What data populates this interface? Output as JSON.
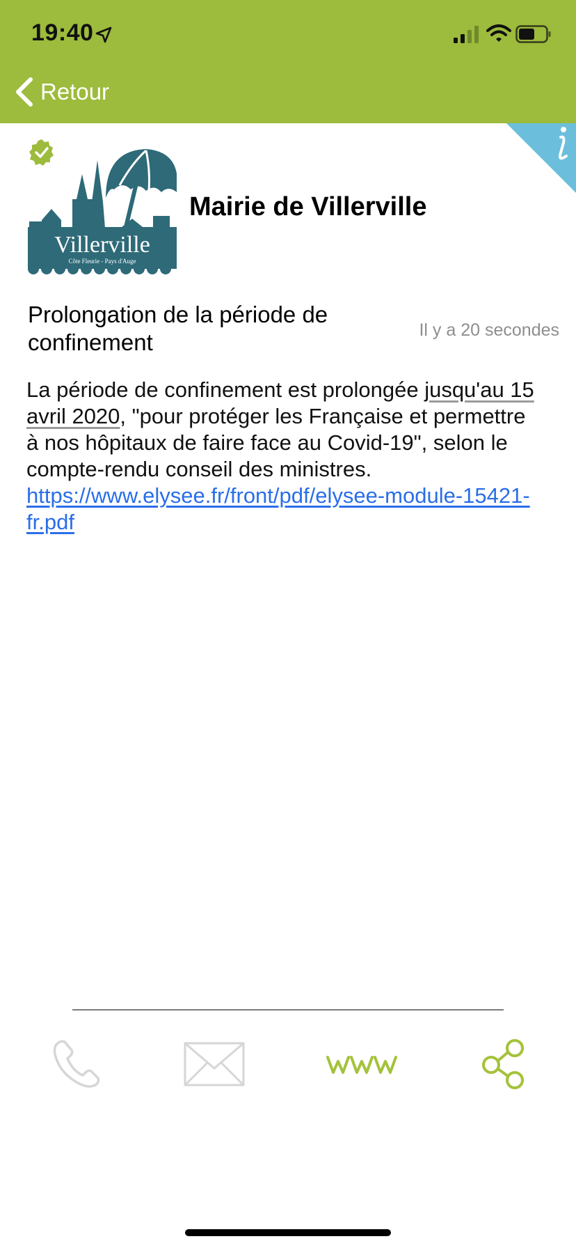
{
  "status_bar": {
    "time": "19:40"
  },
  "nav": {
    "back_label": "Retour"
  },
  "publisher": {
    "name": "Mairie de Villerville",
    "logo_text": "Villerville",
    "logo_subtext": "Côte Fleurie - Pays d'Auge"
  },
  "article": {
    "title": "Prolongation de la période de confinement",
    "timestamp": "Il y a 20 secondes",
    "body_part1": "La période de confinement est prolongée ",
    "body_date": "jusqu'au 15 avril 2020",
    "body_part2": ", \"pour protéger les Française et permettre à nos hôpitaux de faire face au Covid-19\", selon le compte-rendu conseil des ministres. ",
    "link_text": "https://www.elysee.fr/front/pdf/elysee-module-15421-fr.pdf"
  },
  "actions": {
    "www_label": "www"
  },
  "colors": {
    "header_green": "#9dbb3c",
    "accent_green": "#a4c23a",
    "info_blue": "#6bbfdc",
    "disabled_gray": "#d6d6d6",
    "link_blue": "#2a6ee8"
  },
  "icons": [
    "location-arrow-icon",
    "signal-icon",
    "wifi-icon",
    "battery-icon",
    "chevron-left-icon",
    "info-icon",
    "verified-check-icon",
    "phone-icon",
    "mail-icon",
    "www-icon",
    "share-icon"
  ]
}
